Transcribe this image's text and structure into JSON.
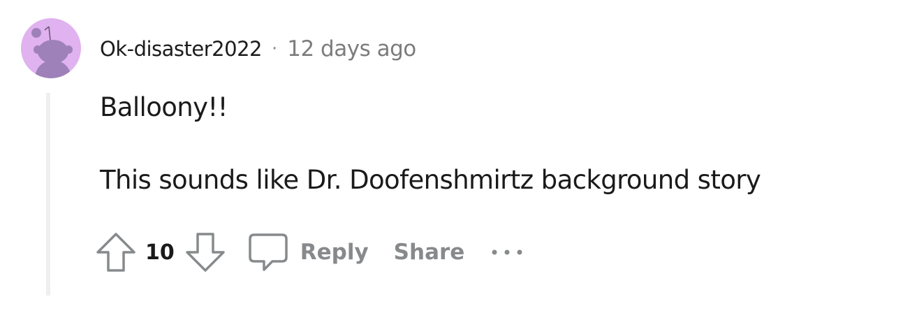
{
  "comment": {
    "author": "Ok-disaster2022",
    "separator": "·",
    "timestamp": "12 days ago",
    "body": [
      "Balloony!!",
      "This sounds like Dr. Doofenshmirtz background story"
    ]
  },
  "actions": {
    "upvote_icon": "upvote-arrow-icon",
    "vote_count": "10",
    "downvote_icon": "downvote-arrow-icon",
    "comment_icon": "speech-bubble-icon",
    "reply_label": "Reply",
    "share_label": "Share",
    "more_icon": "ellipsis-icon"
  },
  "colors": {
    "avatar_background": "#e0b2ef",
    "avatar_figure": "#9f81b9",
    "thread_line": "#edeff1",
    "muted_text": "#878a8c",
    "body_text": "#1a1a1b"
  }
}
